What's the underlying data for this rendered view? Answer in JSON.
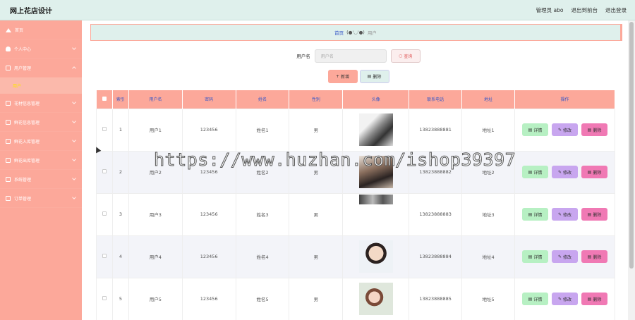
{
  "app": {
    "title": "网上花店设计"
  },
  "topbar": {
    "admin_label": "管理员 abo",
    "backend_link": "退出到前台",
    "logout_link": "退出登录"
  },
  "sidebar": {
    "items": [
      {
        "label": "首页",
        "icon": "home-icon"
      },
      {
        "label": "个人中心",
        "icon": "user-icon"
      },
      {
        "label": "用户管理",
        "icon": "users-icon",
        "expanded": true,
        "sub": [
          {
            "label": "用户"
          }
        ]
      },
      {
        "label": "花材信息管理",
        "icon": "box-icon"
      },
      {
        "label": "鲜花信息管理",
        "icon": "flower-icon"
      },
      {
        "label": "鲜花入库管理",
        "icon": "inbox-icon"
      },
      {
        "label": "鲜花出库管理",
        "icon": "outbox-icon"
      },
      {
        "label": "系统管理",
        "icon": "settings-icon"
      },
      {
        "label": "订单管理",
        "icon": "order-icon"
      }
    ]
  },
  "breadcrumb": {
    "home": "首页",
    "sep": "(●'◡'●)",
    "current": "用户"
  },
  "search": {
    "label": "用户名",
    "placeholder": "用户名",
    "button": "查询"
  },
  "actions": {
    "add": "新增",
    "delete": "删除"
  },
  "table": {
    "headers": [
      "索引",
      "用户名",
      "密码",
      "姓名",
      "性别",
      "头像",
      "联系电话",
      "地址",
      "操作"
    ],
    "op_labels": {
      "detail": "详情",
      "edit": "修改",
      "delete": "删除"
    },
    "rows": [
      {
        "index": "1",
        "username": "用户1",
        "password": "123456",
        "name": "姓名1",
        "gender": "男",
        "phone": "13823888881",
        "address": "地址1"
      },
      {
        "index": "2",
        "username": "用户2",
        "password": "123456",
        "name": "姓名2",
        "gender": "男",
        "phone": "13823888882",
        "address": "地址2"
      },
      {
        "index": "3",
        "username": "用户3",
        "password": "123456",
        "name": "姓名3",
        "gender": "男",
        "phone": "13823888883",
        "address": "地址3"
      },
      {
        "index": "4",
        "username": "用户4",
        "password": "123456",
        "name": "姓名4",
        "gender": "男",
        "phone": "13823888884",
        "address": "地址4"
      },
      {
        "index": "5",
        "username": "用户5",
        "password": "123456",
        "name": "姓名5",
        "gender": "男",
        "phone": "13823888885",
        "address": "地址5"
      }
    ]
  },
  "watermark": "https://www.huzhan.com/ishop39397",
  "colors": {
    "sidebar": "#fca89a",
    "topbar": "#dff0ec",
    "header_text": "#3456c7",
    "detail": "#b7f0c3",
    "edit": "#c8a6ef",
    "delete": "#f079b4"
  }
}
